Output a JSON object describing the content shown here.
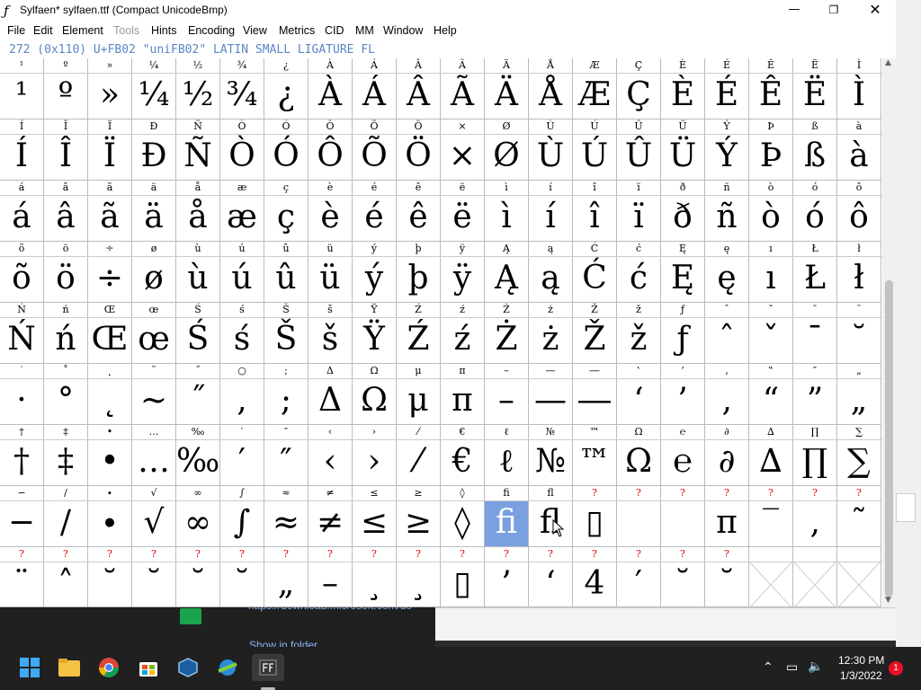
{
  "window": {
    "title": "Sylfaen* sylfaen.ttf (Compact UnicodeBmp)",
    "info": "272 (0x110) U+FB02 \"uniFB02\" LATIN SMALL LIGATURE FL"
  },
  "menu": [
    {
      "label": "File",
      "disabled": false
    },
    {
      "label": "Edit",
      "disabled": false
    },
    {
      "label": "Element",
      "disabled": false
    },
    {
      "label": "Tools",
      "disabled": true
    },
    {
      "label": "Hints",
      "disabled": false
    },
    {
      "label": "Encoding",
      "disabled": false
    },
    {
      "label": "View",
      "disabled": false
    },
    {
      "label": "Metrics",
      "disabled": false
    },
    {
      "label": "CID",
      "disabled": false
    },
    {
      "label": "MM",
      "disabled": false
    },
    {
      "label": "Window",
      "disabled": false
    },
    {
      "label": "Help",
      "disabled": false
    }
  ],
  "selected_glyph_index": 151,
  "grid_columns": 20,
  "glyphs": [
    {
      "l": "¹",
      "g": "¹"
    },
    {
      "l": "º",
      "g": "º"
    },
    {
      "l": "»",
      "g": "»"
    },
    {
      "l": "¼",
      "g": "¼"
    },
    {
      "l": "½",
      "g": "½"
    },
    {
      "l": "¾",
      "g": "¾"
    },
    {
      "l": "¿",
      "g": "¿"
    },
    {
      "l": "À",
      "g": "À"
    },
    {
      "l": "Á",
      "g": "Á"
    },
    {
      "l": "Â",
      "g": "Â"
    },
    {
      "l": "Ã",
      "g": "Ã"
    },
    {
      "l": "Ä",
      "g": "Ä"
    },
    {
      "l": "Å",
      "g": "Å"
    },
    {
      "l": "Æ",
      "g": "Æ"
    },
    {
      "l": "Ç",
      "g": "Ç"
    },
    {
      "l": "È",
      "g": "È"
    },
    {
      "l": "É",
      "g": "É"
    },
    {
      "l": "Ê",
      "g": "Ê"
    },
    {
      "l": "Ë",
      "g": "Ë"
    },
    {
      "l": "Ì",
      "g": "Ì"
    },
    {
      "l": "Í",
      "g": "Í"
    },
    {
      "l": "Î",
      "g": "Î"
    },
    {
      "l": "Ï",
      "g": "Ï"
    },
    {
      "l": "Ð",
      "g": "Ð"
    },
    {
      "l": "Ñ",
      "g": "Ñ"
    },
    {
      "l": "Ò",
      "g": "Ò"
    },
    {
      "l": "Ó",
      "g": "Ó"
    },
    {
      "l": "Ô",
      "g": "Ô"
    },
    {
      "l": "Õ",
      "g": "Õ"
    },
    {
      "l": "Ö",
      "g": "Ö"
    },
    {
      "l": "×",
      "g": "×"
    },
    {
      "l": "Ø",
      "g": "Ø"
    },
    {
      "l": "Ù",
      "g": "Ù"
    },
    {
      "l": "Ú",
      "g": "Ú"
    },
    {
      "l": "Û",
      "g": "Û"
    },
    {
      "l": "Ü",
      "g": "Ü"
    },
    {
      "l": "Ý",
      "g": "Ý"
    },
    {
      "l": "Þ",
      "g": "Þ"
    },
    {
      "l": "ß",
      "g": "ß"
    },
    {
      "l": "à",
      "g": "à"
    },
    {
      "l": "á",
      "g": "á"
    },
    {
      "l": "â",
      "g": "â"
    },
    {
      "l": "ã",
      "g": "ã"
    },
    {
      "l": "ä",
      "g": "ä"
    },
    {
      "l": "å",
      "g": "å"
    },
    {
      "l": "æ",
      "g": "æ"
    },
    {
      "l": "ç",
      "g": "ç"
    },
    {
      "l": "è",
      "g": "è"
    },
    {
      "l": "é",
      "g": "é"
    },
    {
      "l": "ê",
      "g": "ê"
    },
    {
      "l": "ë",
      "g": "ë"
    },
    {
      "l": "ì",
      "g": "ì"
    },
    {
      "l": "í",
      "g": "í"
    },
    {
      "l": "î",
      "g": "î"
    },
    {
      "l": "ï",
      "g": "ï"
    },
    {
      "l": "ð",
      "g": "ð"
    },
    {
      "l": "ñ",
      "g": "ñ"
    },
    {
      "l": "ò",
      "g": "ò"
    },
    {
      "l": "ó",
      "g": "ó"
    },
    {
      "l": "ô",
      "g": "ô"
    },
    {
      "l": "õ",
      "g": "õ"
    },
    {
      "l": "ö",
      "g": "ö"
    },
    {
      "l": "÷",
      "g": "÷"
    },
    {
      "l": "ø",
      "g": "ø"
    },
    {
      "l": "ù",
      "g": "ù"
    },
    {
      "l": "ú",
      "g": "ú"
    },
    {
      "l": "û",
      "g": "û"
    },
    {
      "l": "ü",
      "g": "ü"
    },
    {
      "l": "ý",
      "g": "ý"
    },
    {
      "l": "þ",
      "g": "þ"
    },
    {
      "l": "ÿ",
      "g": "ÿ"
    },
    {
      "l": "Ą",
      "g": "Ą"
    },
    {
      "l": "ą",
      "g": "ą"
    },
    {
      "l": "Ć",
      "g": "Ć"
    },
    {
      "l": "ć",
      "g": "ć"
    },
    {
      "l": "Ę",
      "g": "Ę"
    },
    {
      "l": "ę",
      "g": "ę"
    },
    {
      "l": "ı",
      "g": "ı"
    },
    {
      "l": "Ł",
      "g": "Ł"
    },
    {
      "l": "ł",
      "g": "ł"
    },
    {
      "l": "Ń",
      "g": "Ń"
    },
    {
      "l": "ń",
      "g": "ń"
    },
    {
      "l": "Œ",
      "g": "Œ"
    },
    {
      "l": "œ",
      "g": "œ"
    },
    {
      "l": "Ś",
      "g": "Ś"
    },
    {
      "l": "ś",
      "g": "ś"
    },
    {
      "l": "Š",
      "g": "Š"
    },
    {
      "l": "š",
      "g": "š"
    },
    {
      "l": "Ÿ",
      "g": "Ÿ"
    },
    {
      "l": "Ź",
      "g": "Ź"
    },
    {
      "l": "ź",
      "g": "ź"
    },
    {
      "l": "Ż",
      "g": "Ż"
    },
    {
      "l": "ż",
      "g": "ż"
    },
    {
      "l": "Ž",
      "g": "Ž"
    },
    {
      "l": "ž",
      "g": "ž"
    },
    {
      "l": "ƒ",
      "g": "ƒ"
    },
    {
      "l": "ˆ",
      "g": "ˆ"
    },
    {
      "l": "ˇ",
      "g": "ˇ"
    },
    {
      "l": "ˉ",
      "g": "ˉ"
    },
    {
      "l": "˘",
      "g": "˘"
    },
    {
      "l": "˙",
      "g": "·"
    },
    {
      "l": "˚",
      "g": "°"
    },
    {
      "l": "˛",
      "g": "˛"
    },
    {
      "l": "˜",
      "g": "~"
    },
    {
      "l": "˝",
      "g": "˝"
    },
    {
      "l": "○",
      "g": ","
    },
    {
      "l": ";",
      "g": ";"
    },
    {
      "l": "Δ",
      "g": "Δ"
    },
    {
      "l": "Ω",
      "g": "Ω"
    },
    {
      "l": "μ",
      "g": "μ"
    },
    {
      "l": "π",
      "g": "π"
    },
    {
      "l": "–",
      "g": "–"
    },
    {
      "l": "—",
      "g": "—"
    },
    {
      "l": "―",
      "g": "―"
    },
    {
      "l": "‛",
      "g": "‘"
    },
    {
      "l": "’",
      "g": "’"
    },
    {
      "l": "‚",
      "g": "‚"
    },
    {
      "l": "‟",
      "g": "“"
    },
    {
      "l": "″",
      "g": "”"
    },
    {
      "l": "„",
      "g": "„"
    },
    {
      "l": "†",
      "g": "†"
    },
    {
      "l": "‡",
      "g": "‡"
    },
    {
      "l": "•",
      "g": "•"
    },
    {
      "l": "…",
      "g": "…"
    },
    {
      "l": "‰",
      "g": "‰"
    },
    {
      "l": "′",
      "g": "′"
    },
    {
      "l": "″",
      "g": "″"
    },
    {
      "l": "‹",
      "g": "‹"
    },
    {
      "l": "›",
      "g": "›"
    },
    {
      "l": "⁄",
      "g": "⁄"
    },
    {
      "l": "€",
      "g": "€"
    },
    {
      "l": "ℓ",
      "g": "ℓ"
    },
    {
      "l": "№",
      "g": "№"
    },
    {
      "l": "™",
      "g": "™"
    },
    {
      "l": "Ω",
      "g": "Ω"
    },
    {
      "l": "℮",
      "g": "℮"
    },
    {
      "l": "∂",
      "g": "∂"
    },
    {
      "l": "∆",
      "g": "∆"
    },
    {
      "l": "∏",
      "g": "∏"
    },
    {
      "l": "∑",
      "g": "∑"
    },
    {
      "l": "−",
      "g": "−"
    },
    {
      "l": "∕",
      "g": "∕"
    },
    {
      "l": "∙",
      "g": "∙"
    },
    {
      "l": "√",
      "g": "√"
    },
    {
      "l": "∞",
      "g": "∞"
    },
    {
      "l": "∫",
      "g": "∫"
    },
    {
      "l": "≈",
      "g": "≈"
    },
    {
      "l": "≠",
      "g": "≠"
    },
    {
      "l": "≤",
      "g": "≤"
    },
    {
      "l": "≥",
      "g": "≥"
    },
    {
      "l": "◊",
      "g": "◊"
    },
    {
      "l": "ﬁ",
      "g": "ﬁ"
    },
    {
      "l": "ﬂ",
      "g": "ﬂ"
    },
    {
      "l": "?",
      "g": "▯",
      "q": true
    },
    {
      "l": "?",
      "g": "",
      "q": true
    },
    {
      "l": "?",
      "g": "",
      "q": true
    },
    {
      "l": "?",
      "g": "π",
      "q": true
    },
    {
      "l": "?",
      "g": "‾",
      "q": true
    },
    {
      "l": "?",
      "g": "‚",
      "q": true
    },
    {
      "l": "?",
      "g": "˜",
      "q": true
    },
    {
      "l": "?",
      "g": "¨",
      "q": true
    },
    {
      "l": "?",
      "g": "˄",
      "q": true
    },
    {
      "l": "?",
      "g": "˘",
      "q": true
    },
    {
      "l": "?",
      "g": "˘",
      "q": true
    },
    {
      "l": "?",
      "g": "˘",
      "q": true
    },
    {
      "l": "?",
      "g": "˘",
      "q": true
    },
    {
      "l": "?",
      "g": "„",
      "q": true
    },
    {
      "l": "?",
      "g": "–",
      "q": true
    },
    {
      "l": "?",
      "g": "¸",
      "q": true
    },
    {
      "l": "?",
      "g": "¸",
      "q": true
    },
    {
      "l": "?",
      "g": "▯",
      "q": true
    },
    {
      "l": "?",
      "g": "’",
      "q": true
    },
    {
      "l": "?",
      "g": "‘",
      "q": true
    },
    {
      "l": "?",
      "g": "4",
      "q": true
    },
    {
      "l": "?",
      "g": "′",
      "q": true
    },
    {
      "l": "?",
      "g": "˘",
      "q": true
    },
    {
      "l": "?",
      "g": "˘",
      "q": true
    },
    {
      "l": "",
      "g": "",
      "empty": true
    },
    {
      "l": "",
      "g": "",
      "empty": true
    },
    {
      "l": "",
      "g": "",
      "empty": true
    }
  ],
  "background": {
    "link_text": "https://download.microsoft.com/do",
    "show_in_folder": "Show in folder"
  },
  "taskbar": {
    "time": "12:30 PM",
    "date": "1/3/2022",
    "notification_count": "1",
    "apps": [
      "windows-start-icon",
      "file-explorer-icon",
      "chrome-icon",
      "store-icon",
      "virtualbox-icon",
      "network-tool-icon",
      "fontforge-icon"
    ]
  },
  "colors": {
    "selection": "#7aa0e0",
    "missing_label": "#d00000",
    "info_text": "#5a86c8",
    "taskbar": "#202020"
  }
}
